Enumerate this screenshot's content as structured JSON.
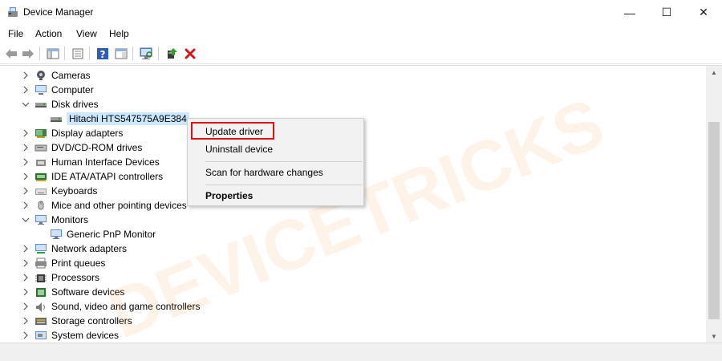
{
  "window": {
    "title": "Device Manager",
    "minimize_glyph": "—",
    "maximize_glyph": "☐",
    "close_glyph": "✕"
  },
  "menu": [
    "File",
    "Action",
    "View",
    "Help"
  ],
  "toolbar": {
    "buttons": [
      "back-arrow-icon",
      "forward-arrow-icon",
      "show-hide-console-tree-icon",
      "properties-sheet-icon",
      "help-icon",
      "action-pane-icon",
      "scan-hardware-icon",
      "update-driver-icon",
      "uninstall-device-icon"
    ]
  },
  "tree": [
    {
      "label": "Cameras",
      "expanded": false,
      "icon": "camera-icon"
    },
    {
      "label": "Computer",
      "expanded": false,
      "icon": "computer-icon"
    },
    {
      "label": "Disk drives",
      "expanded": true,
      "icon": "disk-drive-icon"
    },
    {
      "label": "Hitachi HTS547575A9E384",
      "child": true,
      "selected": true,
      "icon": "disk-drive-icon"
    },
    {
      "label": "Display adapters",
      "expanded": false,
      "icon": "display-adapter-icon"
    },
    {
      "label": "DVD/CD-ROM drives",
      "expanded": false,
      "icon": "dvd-drive-icon"
    },
    {
      "label": "Human Interface Devices",
      "expanded": false,
      "icon": "hid-icon"
    },
    {
      "label": "IDE ATA/ATAPI controllers",
      "expanded": false,
      "icon": "ide-controller-icon"
    },
    {
      "label": "Keyboards",
      "expanded": false,
      "icon": "keyboard-icon"
    },
    {
      "label": "Mice and other pointing devices",
      "expanded": false,
      "icon": "mouse-icon"
    },
    {
      "label": "Monitors",
      "expanded": true,
      "icon": "monitor-icon"
    },
    {
      "label": "Generic PnP Monitor",
      "child": true,
      "icon": "monitor-icon"
    },
    {
      "label": "Network adapters",
      "expanded": false,
      "icon": "network-adapter-icon"
    },
    {
      "label": "Print queues",
      "expanded": false,
      "icon": "printer-icon"
    },
    {
      "label": "Processors",
      "expanded": false,
      "icon": "processor-icon"
    },
    {
      "label": "Software devices",
      "expanded": false,
      "icon": "software-device-icon"
    },
    {
      "label": "Sound, video and game controllers",
      "expanded": false,
      "icon": "speaker-icon"
    },
    {
      "label": "Storage controllers",
      "expanded": false,
      "icon": "storage-controller-icon"
    },
    {
      "label": "System devices",
      "expanded": false,
      "icon": "system-device-icon"
    }
  ],
  "context_menu": {
    "items": [
      "Update driver",
      "Uninstall device",
      "Scan for hardware changes",
      "Properties"
    ],
    "highlighted": "Update driver",
    "highlight_color": "#e01010"
  },
  "watermark": {
    "text": "DEVICETRICKS",
    "color": "#f5a04a"
  },
  "colors": {
    "selection": "#cce8ff",
    "close_red": "#d4141c",
    "help_blue": "#2a5cb8"
  }
}
